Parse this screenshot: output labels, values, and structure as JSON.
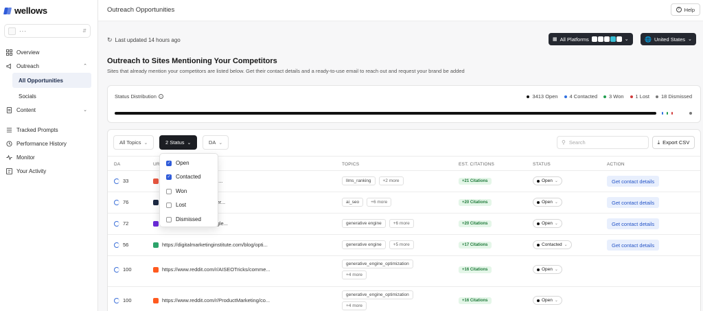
{
  "logo": {
    "text": "wellows",
    "brand_color": "#2f5bd9"
  },
  "workspace": {
    "name": "···"
  },
  "sidebar": {
    "items": [
      {
        "label": "Overview",
        "icon": "grid-icon"
      },
      {
        "label": "Outreach",
        "icon": "megaphone-icon"
      },
      {
        "label": "All Opportunities",
        "active": true
      },
      {
        "label": "Socials"
      },
      {
        "label": "Content",
        "icon": "document-icon"
      },
      {
        "label": "Tracked Prompts",
        "icon": "list-icon"
      },
      {
        "label": "Performance History",
        "icon": "history-icon"
      },
      {
        "label": "Monitor",
        "icon": "pulse-icon"
      },
      {
        "label": "Your Activity",
        "icon": "activity-icon"
      }
    ]
  },
  "header": {
    "title": "Outreach Opportunities",
    "help_label": "Help"
  },
  "toolbar": {
    "last_updated": "Last updated 14 hours ago",
    "platforms_label": "All Platforms",
    "country_label": "United States"
  },
  "section": {
    "title": "Outreach to Sites Mentioning Your Competitors",
    "subtitle": "Sites that already mention your competitors are listed below. Get their contact details and a ready-to-use email to reach out and request your brand be added"
  },
  "status_distribution": {
    "label": "Status Distribution",
    "legend": [
      {
        "text": "3413 Open",
        "value": 3413,
        "color": "#111111"
      },
      {
        "text": "4 Contacted",
        "value": 4,
        "color": "#2f6fe0"
      },
      {
        "text": "3 Won",
        "value": 3,
        "color": "#1f9d4d"
      },
      {
        "text": "1 Lost",
        "value": 1,
        "color": "#d13b3b"
      },
      {
        "text": "18 Dismissed",
        "value": 18,
        "color": "#777777"
      }
    ]
  },
  "filters": {
    "topics_label": "All Topics",
    "status_label": "2 Status",
    "da_label": "DA",
    "search_placeholder": "Search",
    "export_label": "Export CSV"
  },
  "status_dropdown": {
    "options": [
      {
        "label": "Open",
        "checked": true
      },
      {
        "label": "Contacted",
        "checked": true
      },
      {
        "label": "Won",
        "checked": false
      },
      {
        "label": "Lost",
        "checked": false
      },
      {
        "label": "Dismissed",
        "checked": false
      }
    ]
  },
  "table": {
    "headers": {
      "da": "DA",
      "url": "URL",
      "topics": "TOPICS",
      "citations": "EST. CITATIONS",
      "status": "STATUS",
      "action": "ACTION"
    },
    "rows": [
      {
        "da": "33",
        "url": "…/blog/how-to-rank-high...",
        "fav_color": "#e8563f",
        "topic": "llms_ranking",
        "more": "+2 more",
        "citations": "+21 Citations",
        "status": "Open",
        "action": "Get contact details"
      },
      {
        "da": "76",
        "url": "…com/reviews/seo-spider...",
        "fav_color": "#1d2a44",
        "topic": "ai_seo",
        "more": "+6 more",
        "citations": "+20 Citations",
        "status": "Open",
        "action": "Get contact details"
      },
      {
        "da": "72",
        "url": "…com/tech/931416/google...",
        "fav_color": "#6a2bd9",
        "topic": "generative engine",
        "more": "+6 more",
        "citations": "+20 Citations",
        "status": "Open",
        "action": "Get contact details"
      },
      {
        "da": "56",
        "url": "https://digitalmarketinginstitute.com/blog/opti...",
        "fav_color": "#2ca36a",
        "topic": "generative engine",
        "more": "+5 more",
        "citations": "+17 Citations",
        "status": "Contacted",
        "action": "Get contact details"
      },
      {
        "da": "100",
        "url": "https://www.reddit.com/r/AISEOTricks/comme...",
        "fav_color": "#ff5a1f",
        "topic": "generative_engine_optimization",
        "more": "+4 more",
        "citations": "+16 Citations",
        "status": "Open",
        "action": ""
      },
      {
        "da": "100",
        "url": "https://www.reddit.com/r/ProductMarketing/co...",
        "fav_color": "#ff5a1f",
        "topic": "generative_engine_optimization",
        "more": "+4 more",
        "citations": "+16 Citations",
        "status": "Open",
        "action": ""
      }
    ]
  }
}
